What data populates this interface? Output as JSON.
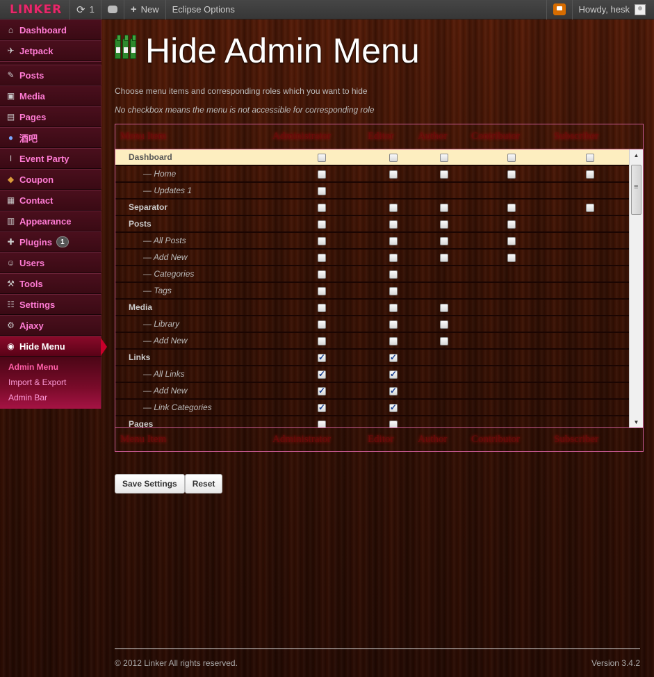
{
  "adminbar": {
    "logo": "LINKER",
    "updates_count": "1",
    "new_label": "New",
    "eclipse_label": "Eclipse Options",
    "howdy": "Howdy, hesk"
  },
  "sidebar": {
    "items": [
      {
        "label": "Dashboard",
        "icon": "house-icon"
      },
      {
        "label": "Jetpack",
        "icon": "jetpack-icon"
      },
      {
        "label": "Posts",
        "icon": "pin-icon"
      },
      {
        "label": "Media",
        "icon": "media-icon"
      },
      {
        "label": "Pages",
        "icon": "pages-icon"
      },
      {
        "label": "酒吧",
        "icon": "drop-icon"
      },
      {
        "label": "Event Party",
        "icon": "candle-icon"
      },
      {
        "label": "Coupon",
        "icon": "coupon-icon"
      },
      {
        "label": "Contact",
        "icon": "contact-icon"
      },
      {
        "label": "Appearance",
        "icon": "appearance-icon"
      },
      {
        "label": "Plugins",
        "icon": "plugin-icon",
        "badge": "1"
      },
      {
        "label": "Users",
        "icon": "users-icon"
      },
      {
        "label": "Tools",
        "icon": "tools-icon"
      },
      {
        "label": "Settings",
        "icon": "settings-icon"
      },
      {
        "label": "Ajaxy",
        "icon": "gear-icon"
      },
      {
        "label": "Hide Menu",
        "icon": "eye-icon"
      }
    ],
    "submenu": [
      "Admin Menu",
      "Import & Export",
      "Admin Bar"
    ]
  },
  "main": {
    "title": "Hide Admin Menu",
    "desc1": "Choose menu items and corresponding roles which you want to hide",
    "desc2": "No checkbox means the menu is not accessible for corresponding role",
    "columns": [
      "Menu Item",
      "Administrator",
      "Editor",
      "Author",
      "Contributor",
      "Subscriber"
    ],
    "rows": [
      {
        "label": "Dashboard",
        "sub": false,
        "hl": true,
        "cells": [
          0,
          0,
          0,
          0,
          0
        ]
      },
      {
        "label": "— Home",
        "sub": true,
        "cells": [
          0,
          0,
          0,
          0,
          0
        ]
      },
      {
        "label": "— Updates 1",
        "sub": true,
        "cells": [
          0,
          null,
          null,
          null,
          null
        ]
      },
      {
        "label": "Separator",
        "sub": false,
        "cells": [
          0,
          0,
          0,
          0,
          0
        ]
      },
      {
        "label": "Posts",
        "sub": false,
        "cells": [
          0,
          0,
          0,
          0,
          null
        ]
      },
      {
        "label": "— All Posts",
        "sub": true,
        "cells": [
          0,
          0,
          0,
          0,
          null
        ]
      },
      {
        "label": "— Add New",
        "sub": true,
        "cells": [
          0,
          0,
          0,
          0,
          null
        ]
      },
      {
        "label": "— Categories",
        "sub": true,
        "cells": [
          0,
          0,
          null,
          null,
          null
        ]
      },
      {
        "label": "— Tags",
        "sub": true,
        "cells": [
          0,
          0,
          null,
          null,
          null
        ]
      },
      {
        "label": "Media",
        "sub": false,
        "cells": [
          0,
          0,
          0,
          null,
          null
        ]
      },
      {
        "label": "— Library",
        "sub": true,
        "cells": [
          0,
          0,
          0,
          null,
          null
        ]
      },
      {
        "label": "— Add New",
        "sub": true,
        "cells": [
          0,
          0,
          0,
          null,
          null
        ]
      },
      {
        "label": "Links",
        "sub": false,
        "cells": [
          1,
          1,
          null,
          null,
          null
        ]
      },
      {
        "label": "— All Links",
        "sub": true,
        "cells": [
          1,
          1,
          null,
          null,
          null
        ]
      },
      {
        "label": "— Add New",
        "sub": true,
        "cells": [
          1,
          1,
          null,
          null,
          null
        ]
      },
      {
        "label": "— Link Categories",
        "sub": true,
        "cells": [
          1,
          1,
          null,
          null,
          null
        ]
      },
      {
        "label": "Pages",
        "sub": false,
        "cells": [
          0,
          0,
          null,
          null,
          null
        ]
      }
    ],
    "save_label": "Save Settings",
    "reset_label": "Reset"
  },
  "footer": {
    "copyright": "© 2012 Linker All rights reserved.",
    "version": "Version 3.4.2"
  },
  "colors": {
    "accent": "#ff7bd4",
    "active_menu": "#8a0a2a",
    "highlight_row": "#fdeec0"
  }
}
